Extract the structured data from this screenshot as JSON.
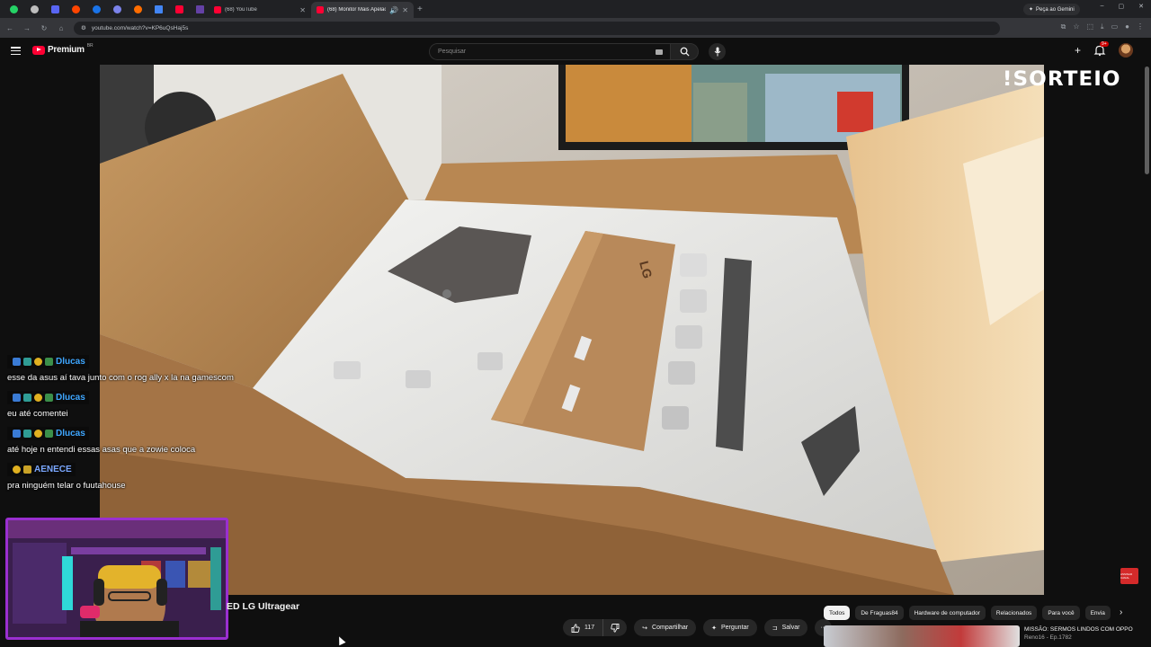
{
  "browser": {
    "tabs": [
      {
        "title": "(68) YouTube",
        "active": false
      },
      {
        "title": "(68) Monitor Mais Apelão d",
        "active": true
      }
    ],
    "pinned_tab_icons": [
      "whatsapp-icon",
      "chrome-icon",
      "discord-icon",
      "reddit-icon",
      "edge-icon",
      "teams-icon",
      "fire-icon",
      "doc-icon",
      "youtube-icon",
      "twitch-icon"
    ],
    "new_tab_label": "+",
    "gemini_label": "Peça ao Gemini",
    "url": "youtube.com/watch?v=KP6uQsHaj5s",
    "window_controls": [
      "–",
      "▢",
      "✕"
    ]
  },
  "youtube": {
    "logo_text": "Premium",
    "country_code": "BR",
    "search_placeholder": "Pesquisar",
    "notification_count": "9+",
    "create_label": "+"
  },
  "video": {
    "overlay_watermark": "!SORTEIO",
    "subscribe_badge": "ASSINAR CANAL",
    "title_visible": "ED LG Ultragear",
    "like_count": "117",
    "actions": {
      "share": "Compartilhar",
      "ask": "Perguntar",
      "save": "Salvar",
      "more": "···"
    }
  },
  "chat": [
    {
      "user": "Dlucas",
      "user_color": "#3ea6ff",
      "text": "esse da asus aí tava junto com o rog ally x la na gamescom"
    },
    {
      "user": "Dlucas",
      "user_color": "#3ea6ff",
      "text": "eu até comentei"
    },
    {
      "user": "Dlucas",
      "user_color": "#3ea6ff",
      "text": "até hoje n entendi essas asas que a zowie coloca"
    },
    {
      "user": "AENECE",
      "user_color": "#7aa7ff",
      "text": "pra ninguém telar o fuutahouse"
    }
  ],
  "chips": [
    "Todos",
    "De Fraguas84",
    "Hardware de computador",
    "Relacionados",
    "Para você",
    "Envia"
  ],
  "recommendation": {
    "title": "MISSÃO: SERMOS LINDOS COM OPPO",
    "channel": "Reno16 - Ep.1782"
  }
}
